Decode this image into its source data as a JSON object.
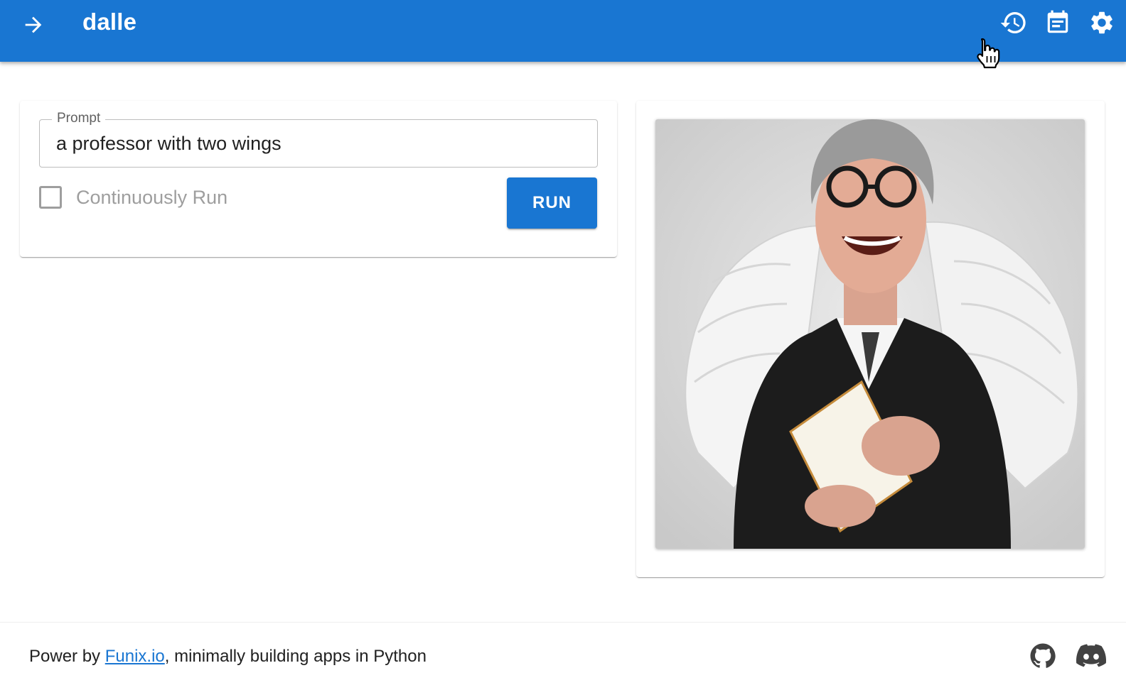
{
  "appbar": {
    "title": "dalle",
    "color": "#1976d2",
    "menu_icon": "arrow-right-icon",
    "actions": [
      "history-icon",
      "calendar-note-icon",
      "settings-gear-icon"
    ]
  },
  "form": {
    "prompt_label": "Prompt",
    "prompt_value": "a professor with two wings",
    "continuously_run_label": "Continuously Run",
    "continuously_run_checked": false,
    "run_button_label": "RUN"
  },
  "output": {
    "image_subject": "generated-image"
  },
  "footer": {
    "prefix": "Power by ",
    "link_text": "Funix.io",
    "suffix": ", minimally building apps in Python",
    "link_color": "#1976d2",
    "icons": [
      "github-icon",
      "discord-icon"
    ]
  }
}
